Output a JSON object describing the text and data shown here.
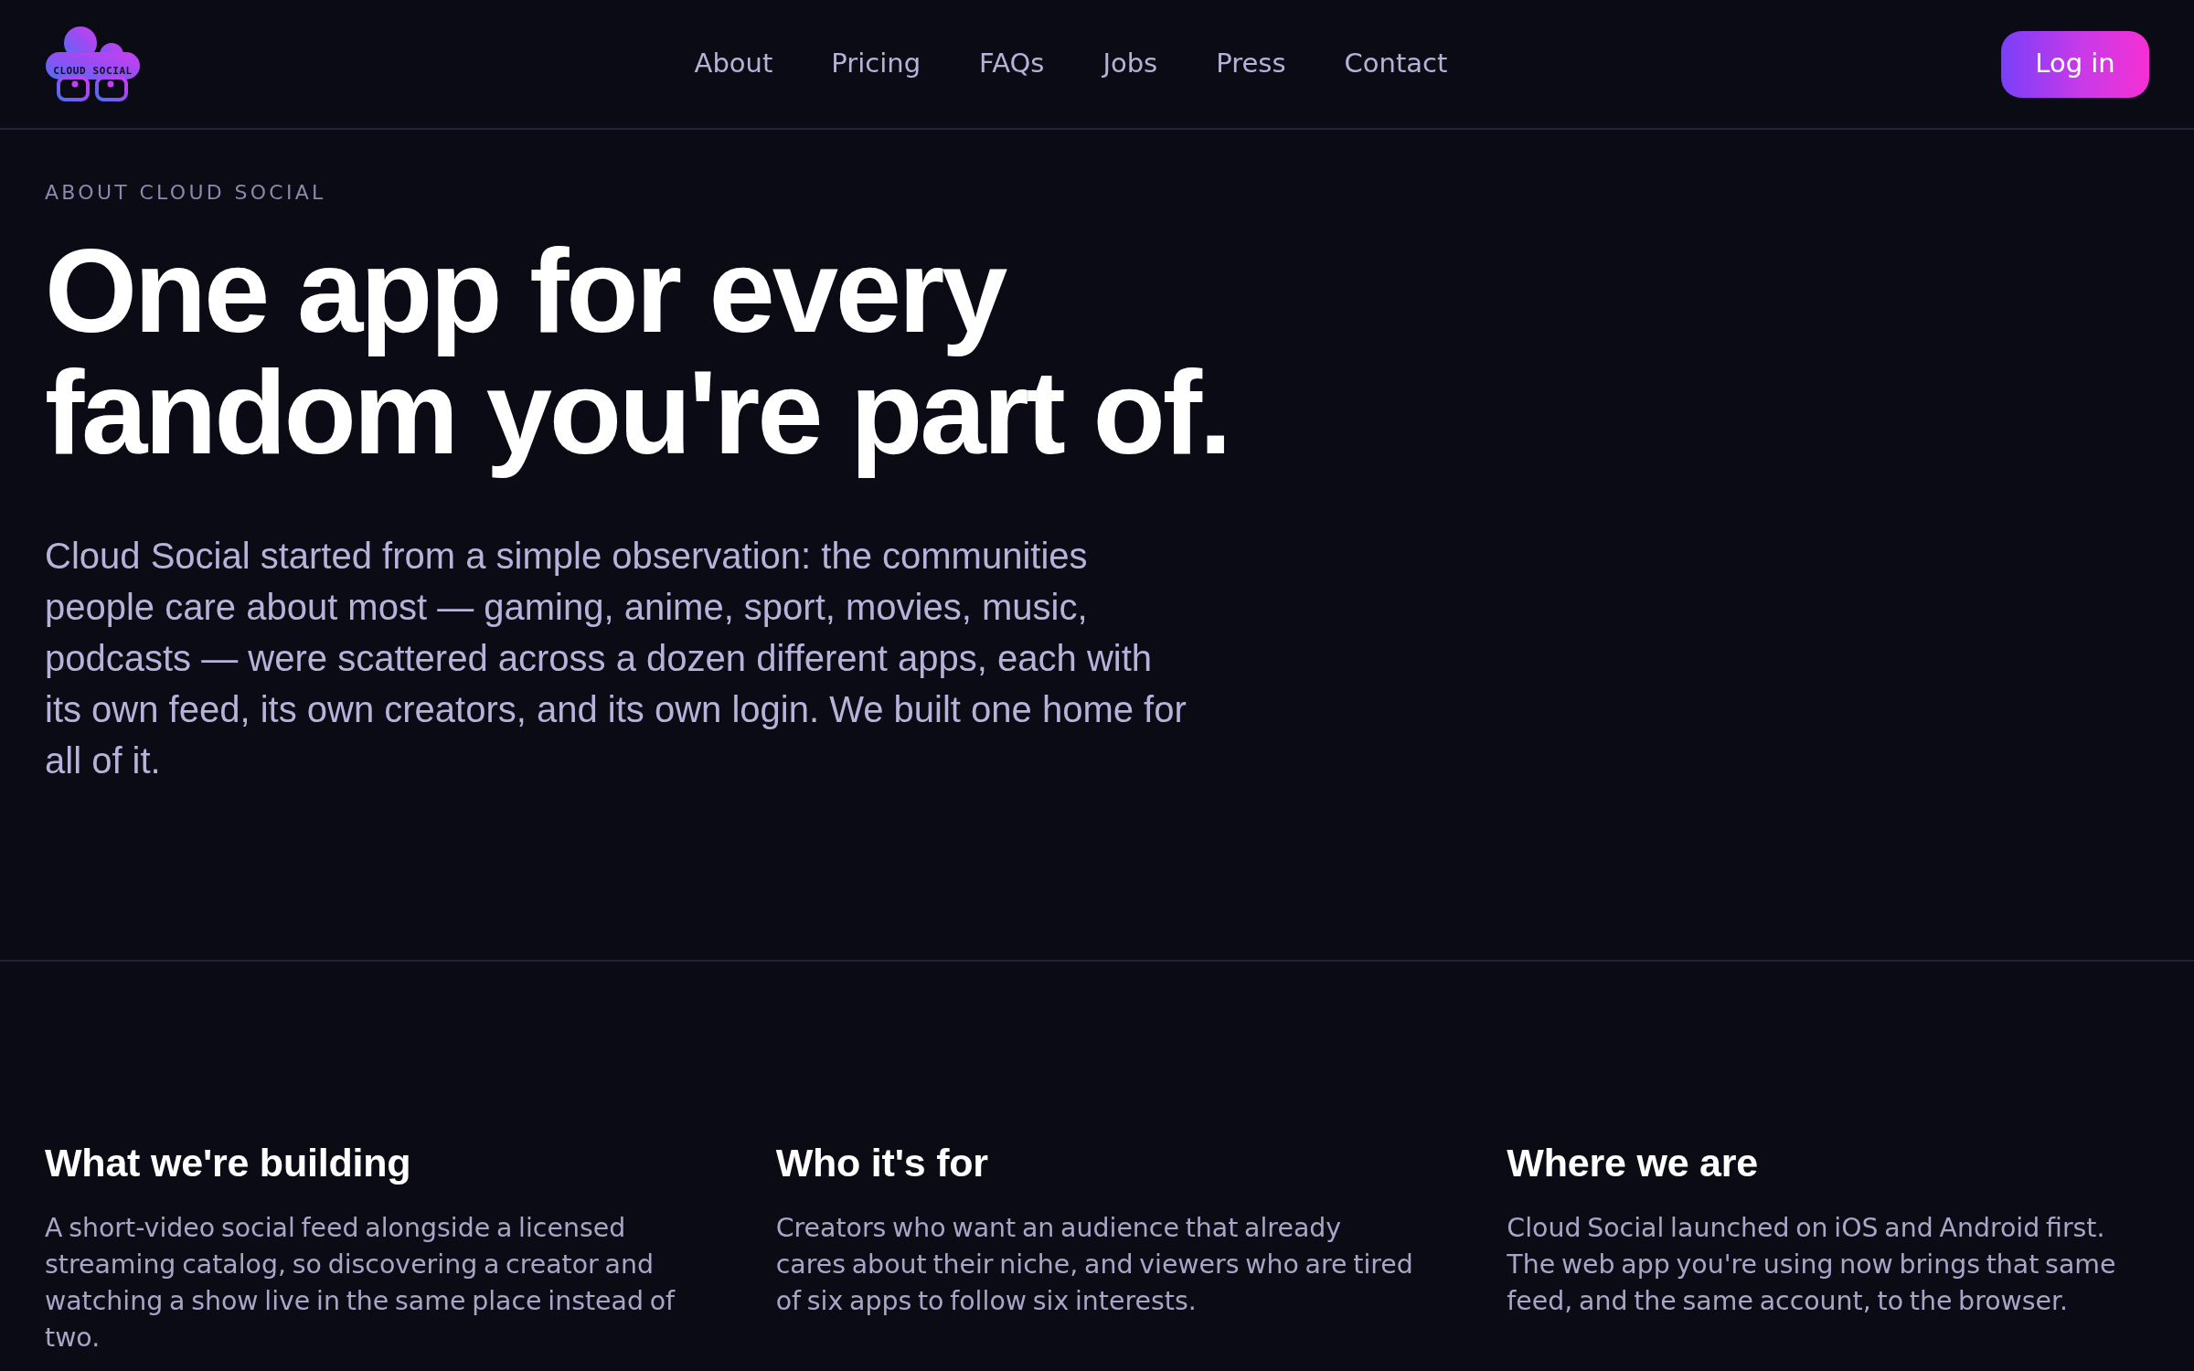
{
  "header": {
    "logo_text": "CLOUD SOCIAL",
    "nav_links": [
      "About",
      "Pricing",
      "FAQs",
      "Jobs",
      "Press",
      "Contact"
    ],
    "login_button": "Log in"
  },
  "hero": {
    "eyebrow": "ABOUT CLOUD SOCIAL",
    "title": "One app for every fandom you're part of.",
    "intro": "Cloud Social started from a simple observation: the communities people care about most — gaming, anime, sport, movies, music, podcasts — were scattered across a dozen different apps, each with its own feed, its own creators, and its own login. We built one home for all of it."
  },
  "sections": [
    {
      "heading": "What we're building",
      "text": "A short-video social feed alongside a licensed streaming catalog, so discovering a creator and watching a show live in the same place instead of two."
    },
    {
      "heading": "Who it's for",
      "text": "Creators who want an audience that already cares about their niche, and viewers who are tired of six apps to follow six interests."
    },
    {
      "heading": "Where we are",
      "text": "Cloud Social launched on iOS and Android first. The web app you're using now brings that same feed, and the same account, to the browser."
    }
  ]
}
